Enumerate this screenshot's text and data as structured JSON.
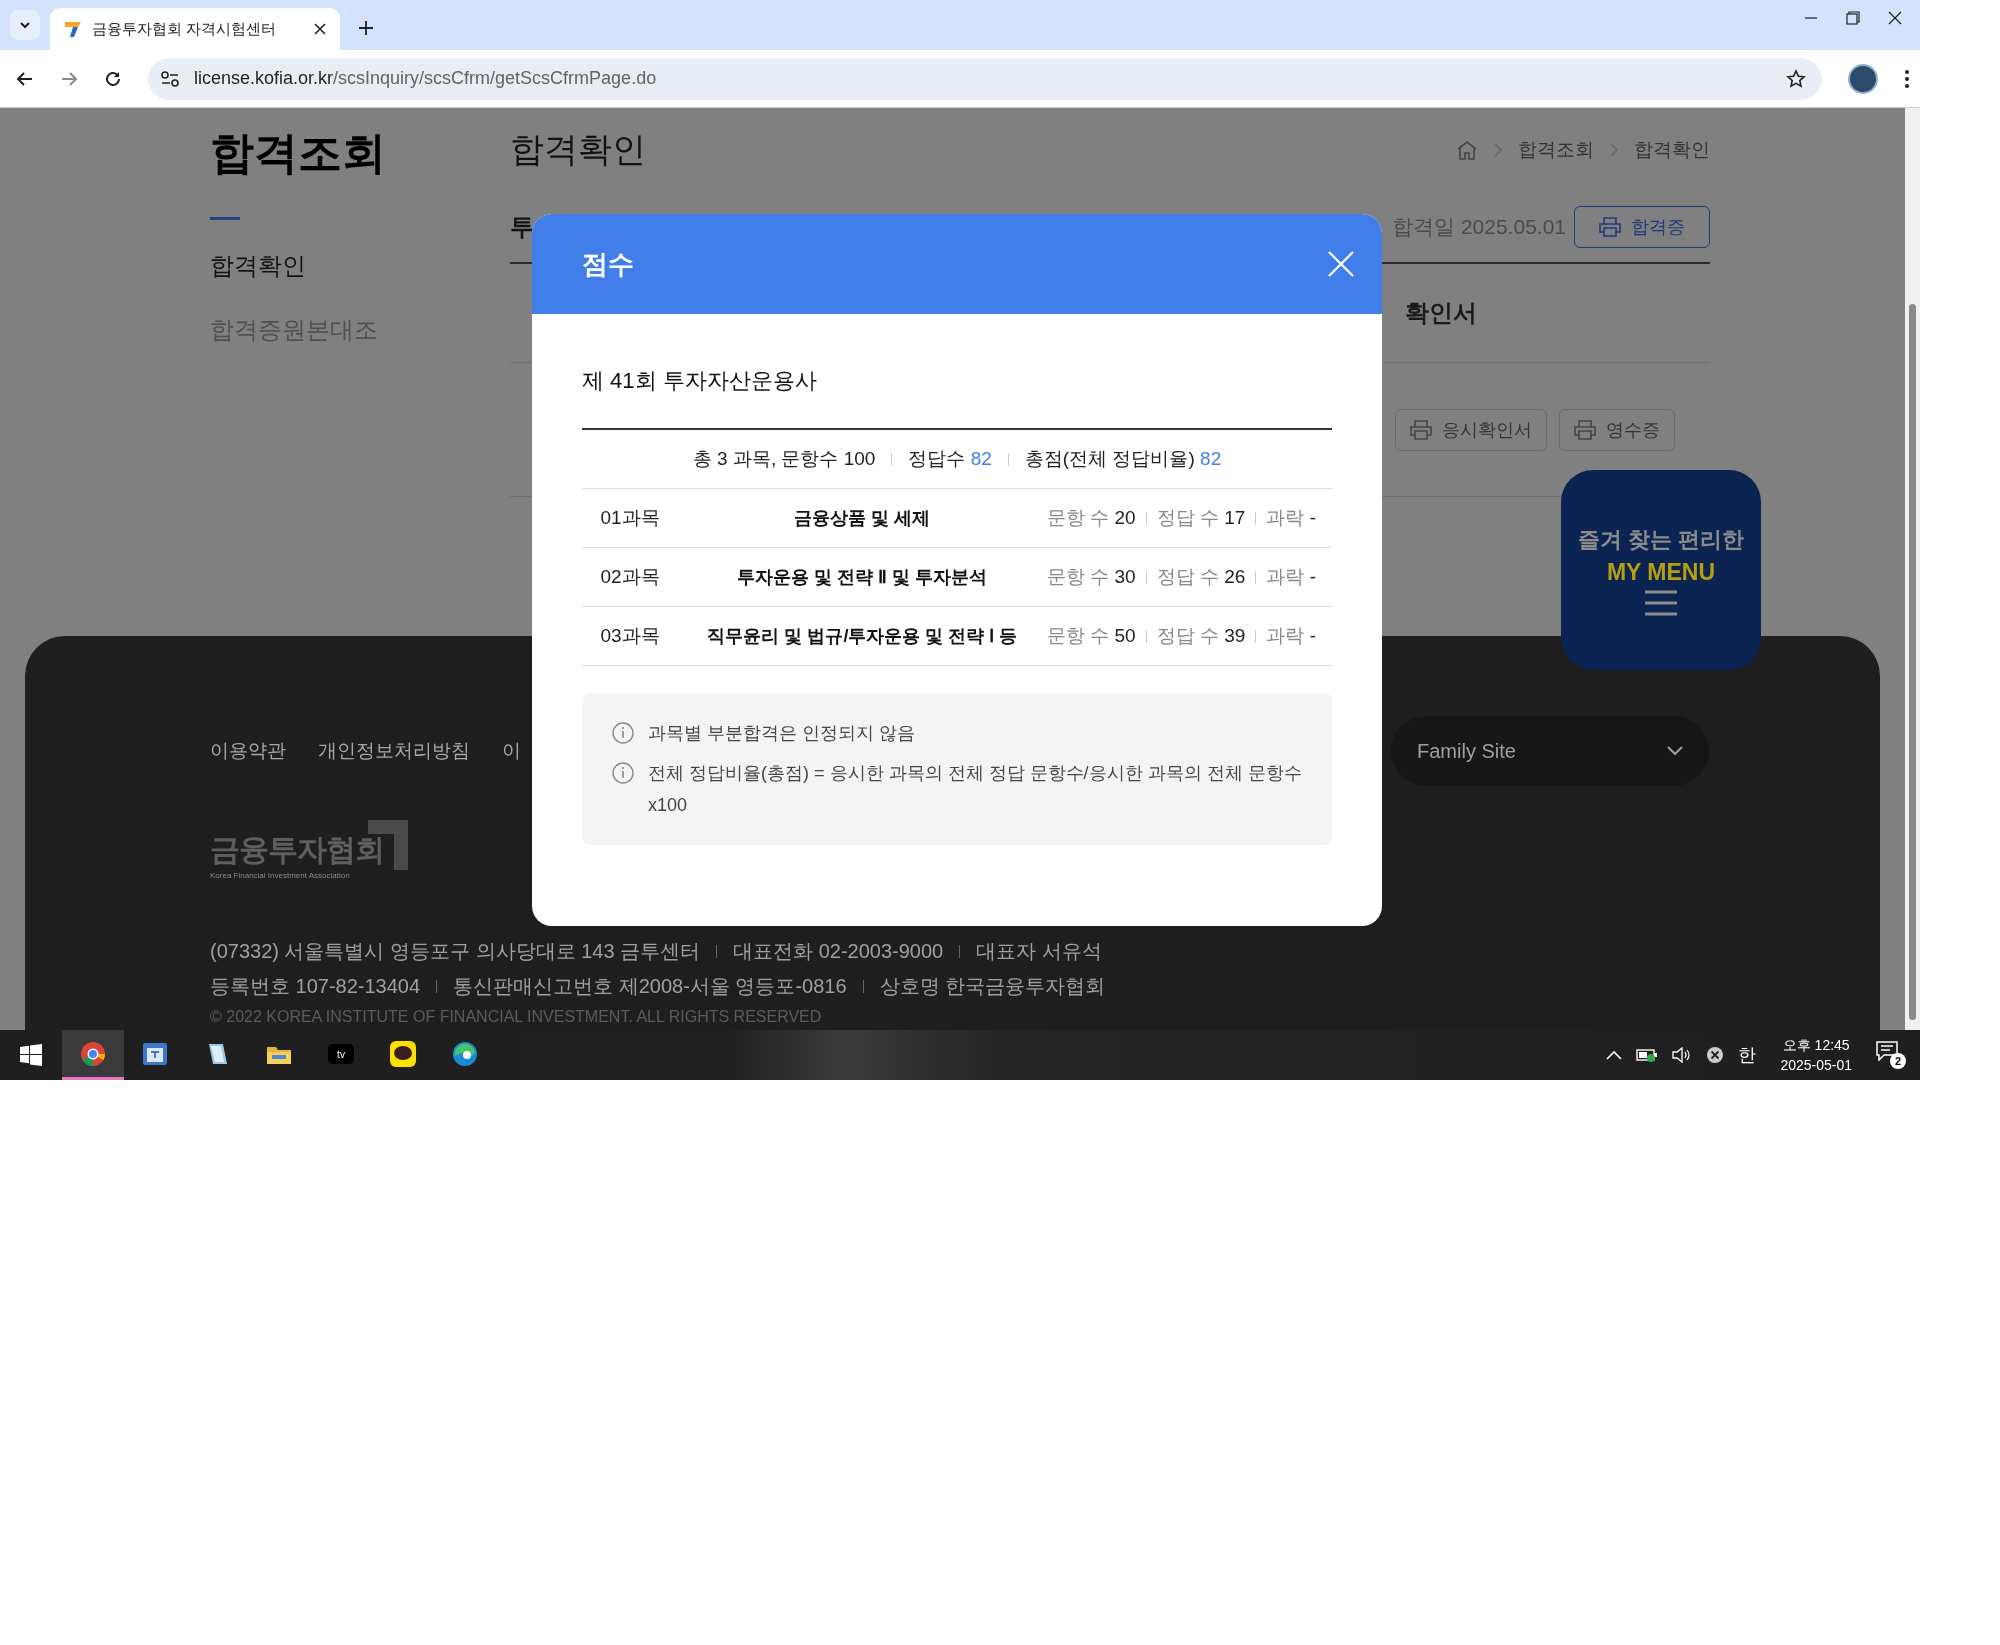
{
  "browser": {
    "tabs": [
      {
        "title": "금융투자협회 자격시험센터",
        "selected": true
      }
    ],
    "url": {
      "host": "license.kofia.or.kr",
      "path": "/scsInquiry/scsCfrm/getScsCfrmPage.do"
    }
  },
  "page": {
    "sidebar": {
      "title": "합격조회",
      "items": [
        {
          "label": "합격확인",
          "selected": true
        },
        {
          "label": "합격증원본대조",
          "selected": false
        }
      ]
    },
    "heading": "합격확인",
    "breadcrumb": [
      "합격조회",
      "합격확인"
    ],
    "tab_label": "투",
    "pass_date": "합격일 2025.05.01",
    "cert_button": "합격증",
    "section_label": "확인서",
    "doc_buttons": [
      "응시확인서",
      "영수증"
    ],
    "my_menu": {
      "line_1": "즐겨 찾는 편리한",
      "line_2": "MY MENU"
    }
  },
  "footer": {
    "links": [
      "이용약관",
      "개인정보처리방침",
      "이"
    ],
    "family_site": "Family Site",
    "logo": {
      "name": "금융투자협회",
      "tagline": "Korea Financial Investment Association"
    },
    "info_lines": [
      [
        "(07332) 서울특별시 영등포구 의사당대로 143 금투센터",
        "대표전화 02-2003-9000",
        "대표자 서유석"
      ],
      [
        "등록번호 107-82-13404",
        "통신판매신고번호 제2008-서울 영등포-0816",
        "상호명 한국금융투자협회"
      ]
    ],
    "copyright": "© 2022 KOREA INSTITUTE OF FINANCIAL INVESTMENT. ALL RIGHTS RESERVED"
  },
  "modal": {
    "title": "점수",
    "exam": "제 41회 투자자산운용사",
    "summary": [
      {
        "label": "총 3 과목, 문항수 100"
      },
      {
        "label": "정답수",
        "value": "82"
      },
      {
        "label": "총점(전체 정답비율)",
        "value": "82"
      }
    ],
    "subjects": [
      {
        "no": "01과목",
        "name": "금융상품 및 세제",
        "questions_label": "문항 수",
        "questions": "20",
        "correct_label": "정답 수",
        "correct": "17",
        "fail_label": "과락",
        "fail": "-"
      },
      {
        "no": "02과목",
        "name": "투자운용 및 전략 Ⅱ 및 투자분석",
        "questions_label": "문항 수",
        "questions": "30",
        "correct_label": "정답 수",
        "correct": "26",
        "fail_label": "과락",
        "fail": "-"
      },
      {
        "no": "03과목",
        "name": "직무윤리 및 법규/투자운용 및 전략 Ⅰ 등",
        "questions_label": "문항 수",
        "questions": "50",
        "correct_label": "정답 수",
        "correct": "39",
        "fail_label": "과락",
        "fail": "-"
      }
    ],
    "notes": [
      "과목별 부분합격은 인정되지 않음",
      "전체 정답비율(총점) = 응시한 과목의 전체 정답 문항수/응시한 과목의 전체 문항수 x100"
    ]
  },
  "taskbar": {
    "apps": [
      {
        "kind": "chrome",
        "selected": true
      },
      {
        "kind": "hangul",
        "selected": false
      },
      {
        "kind": "notebook",
        "selected": false
      },
      {
        "kind": "folder",
        "selected": false
      },
      {
        "kind": "tv",
        "selected": false
      },
      {
        "kind": "talk",
        "selected": false
      },
      {
        "kind": "edge",
        "selected": false
      }
    ],
    "ime": "한",
    "time": "오후 12:45",
    "date": "2025-05-01",
    "notifications": "2"
  }
}
